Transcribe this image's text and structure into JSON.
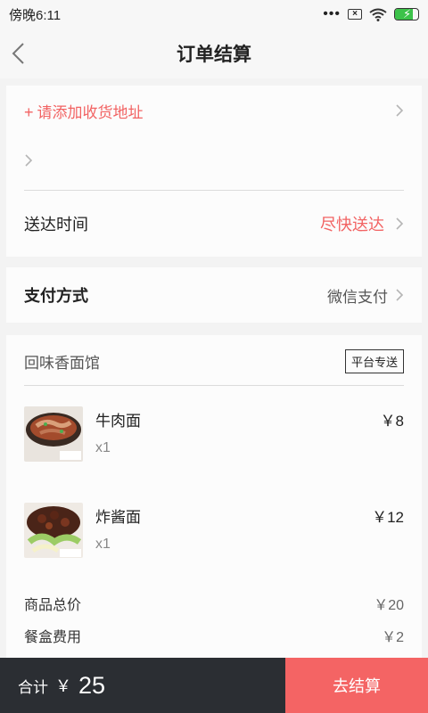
{
  "status_bar": {
    "time": "傍晚6:11"
  },
  "nav": {
    "title": "订单结算"
  },
  "address": {
    "add_label": "请添加收货地址",
    "plus": "+"
  },
  "delivery": {
    "label": "送达时间",
    "value": "尽快送达"
  },
  "payment": {
    "label": "支付方式",
    "value": "微信支付"
  },
  "shop": {
    "name": "回味香面馆",
    "tag": "平台专送"
  },
  "items": [
    {
      "name": "牛肉面",
      "qty": "x1",
      "price": "￥8"
    },
    {
      "name": "炸酱面",
      "qty": "x1",
      "price": "￥12"
    }
  ],
  "summary": {
    "goods_label": "商品总价",
    "goods_value": "￥20",
    "box_label": "餐盒费用",
    "box_value": "￥2"
  },
  "footer": {
    "total_label": "合计",
    "currency": "￥",
    "total_amount": "25",
    "checkout_label": "去结算"
  },
  "colors": {
    "accent": "#f26363",
    "checkout": "#f46464",
    "footer_dark": "#2b2e33"
  },
  "icons": {
    "back": "chevron-left-icon",
    "forward": "chevron-right-icon",
    "signal": "wifi-icon",
    "battery": "battery-charging-icon"
  },
  "battery_level": 0.75
}
